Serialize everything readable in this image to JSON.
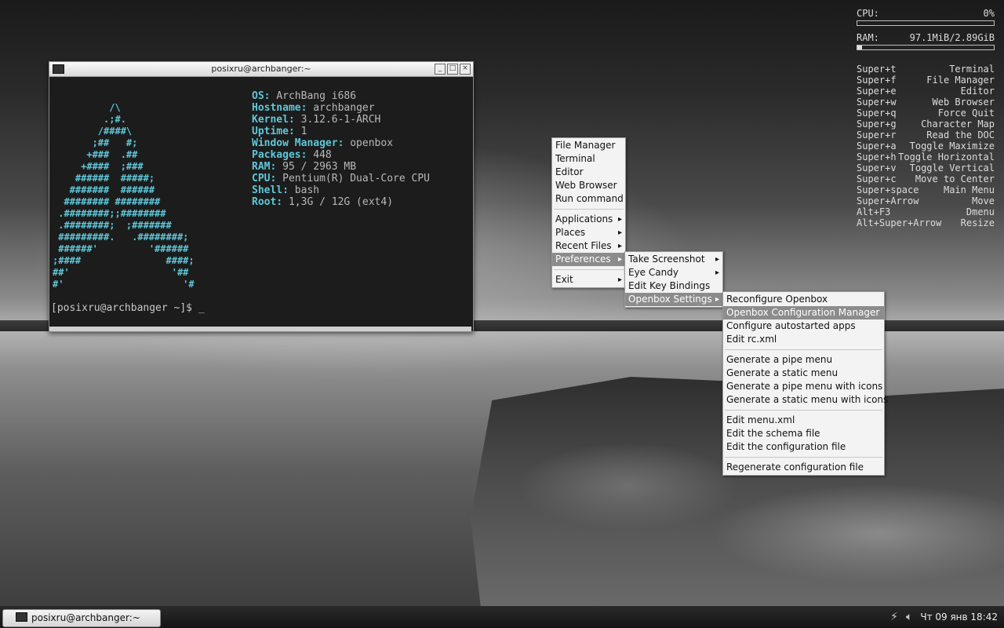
{
  "terminal": {
    "title": "posixru@archbanger:~",
    "buttons": {
      "minimize": "_",
      "maximize": "□",
      "close": "×"
    },
    "ascii_logo": "          /\\\n         .;#.\n        /####\\\n       ;##   #;\n      +###  .##\n     +####  ;###\n    ######  #####;\n   #######  ######\n  ######## ########\n .########;;########\n .########;  ;#######\n #########.   .########;\n ######'         '######\n;####               ####;\n##'                  '##\n#'                     '#",
    "info": [
      {
        "key": "OS:",
        "value": "ArchBang i686"
      },
      {
        "key": "Hostname:",
        "value": "archbanger"
      },
      {
        "key": "Kernel:",
        "value": "3.12.6-1-ARCH"
      },
      {
        "key": "Uptime:",
        "value": "1"
      },
      {
        "key": "Window Manager:",
        "value": "openbox"
      },
      {
        "key": "Packages:",
        "value": "448"
      },
      {
        "key": "RAM:",
        "value": "95 / 2963 MB"
      },
      {
        "key": "CPU:",
        "value": "Pentium(R) Dual-Core CPU"
      },
      {
        "key": "Shell:",
        "value": "bash"
      },
      {
        "key": "Root:",
        "value": "1,3G / 12G (ext4)"
      }
    ],
    "prompt": "[posixru@archbanger ~]$ _"
  },
  "conky": {
    "cpu_label": "CPU:",
    "cpu_value": "0%",
    "cpu_fraction": 0.0,
    "ram_label": "RAM:",
    "ram_value": "97.1MiB/2.89GiB",
    "ram_fraction": 0.033,
    "shortcuts": [
      {
        "key": "Super+t",
        "action": "Terminal"
      },
      {
        "key": "Super+f",
        "action": "File Manager"
      },
      {
        "key": "Super+e",
        "action": "Editor"
      },
      {
        "key": "Super+w",
        "action": "Web Browser"
      },
      {
        "key": "Super+q",
        "action": "Force Quit"
      },
      {
        "key": "Super+g",
        "action": "Character Map"
      },
      {
        "key": "Super+r",
        "action": "Read the DOC"
      },
      {
        "key": "Super+a",
        "action": "Toggle Maximize"
      },
      {
        "key": "Super+h",
        "action": "Toggle Horizontal"
      },
      {
        "key": "Super+v",
        "action": "Toggle Vertical"
      },
      {
        "key": "Super+c",
        "action": "Move to Center"
      },
      {
        "key": "Super+space",
        "action": "Main Menu"
      },
      {
        "key": "Super+Arrow",
        "action": "Move"
      },
      {
        "key": "Alt+F3",
        "action": "Dmenu"
      },
      {
        "key": "Alt+Super+Arrow",
        "action": "Resize"
      }
    ]
  },
  "main_menu": {
    "file_manager": "File Manager",
    "terminal": "Terminal",
    "editor": "Editor",
    "web_browser": "Web Browser",
    "run_command": "Run command",
    "applications": "Applications",
    "places": "Places",
    "recent_files": "Recent Files",
    "preferences": "Preferences",
    "exit": "Exit"
  },
  "preferences_menu": {
    "take_screenshot": "Take Screenshot",
    "eye_candy": "Eye Candy",
    "edit_key_bindings": "Edit Key Bindings",
    "openbox_settings": "Openbox Settings"
  },
  "openbox_menu": {
    "reconfigure": "Reconfigure Openbox",
    "config_manager": "Openbox Configuration Manager",
    "autostarted": "Configure autostarted apps",
    "edit_rcxml": "Edit rc.xml",
    "gen_pipe": "Generate a pipe menu",
    "gen_static": "Generate a static menu",
    "gen_pipe_icons": "Generate a pipe menu with icons",
    "gen_static_icons": "Generate a static menu with icons",
    "edit_menuxml": "Edit menu.xml",
    "edit_schema": "Edit the schema file",
    "edit_config": "Edit the configuration file",
    "regenerate": "Regenerate configuration file"
  },
  "taskbar": {
    "task_label": "posixru@archbanger:~",
    "clock": "Чт 09 янв 18:42",
    "icons": [
      "network-icon",
      "volume-icon"
    ]
  }
}
